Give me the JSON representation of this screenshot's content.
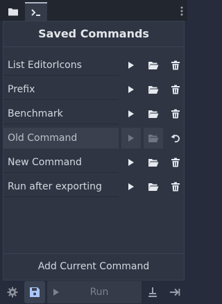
{
  "tabs": [
    {
      "icon": "folder-icon",
      "active": false
    },
    {
      "icon": "terminal-icon",
      "active": true
    }
  ],
  "panel": {
    "title": "Saved Commands",
    "commands": [
      {
        "label": "List EditorIcons",
        "disabled": false,
        "action": "delete"
      },
      {
        "label": "Prefix",
        "disabled": false,
        "action": "delete"
      },
      {
        "label": "Benchmark",
        "disabled": false,
        "action": "delete"
      },
      {
        "label": "Old Command",
        "disabled": true,
        "action": "undo"
      },
      {
        "label": "New Command",
        "disabled": false,
        "action": "delete"
      },
      {
        "label": "Run after exporting",
        "disabled": false,
        "action": "delete"
      }
    ],
    "add_label": "Add Current Command"
  },
  "bottom": {
    "run_label": "Run"
  },
  "colors": {
    "background": "#262c3b",
    "panel": "#2f3543",
    "text": "#d4d8df",
    "disabled": "#7b828e",
    "save_accent": "#a9c7ff"
  }
}
